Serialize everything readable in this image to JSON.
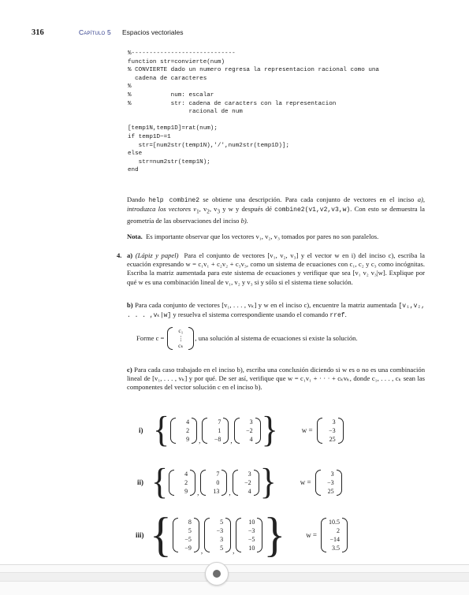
{
  "header": {
    "page_number": "316",
    "chapter": "Capítulo 5",
    "chapter_title": "Espacios vectoriales"
  },
  "code": "%-----------------------------\nfunction str=convierte(num)\n% CONVIERTE dado un numero regresa la representacion racional como una\n  cadena de caracteres\n%\n%           num: escalar\n%           str: cadena de caracters con la representacion\n                 racional de num\n\n[temp1N,temp1D]=rat(num);\nif temp1D~=1\n   str=[num2str(temp1N),'/',num2str(temp1D)];\nelse\n   str=num2str(temp1N);\nend",
  "para1": {
    "a": "Dando ",
    "cmd1": "help combine2",
    "b": " se obtiene una descripción. Para cada conjunto de vectores en el inciso ",
    "c": "a), introduzca los vectores v",
    "d": ", v",
    "e": ", v",
    "f": " y w y después dé ",
    "cmd2": "combine2(v1,v2,v3,w)",
    "g": ". Con esto se demuestra la geometría de las observaciones del inciso ",
    "h": "b)."
  },
  "nota": {
    "label": "Nota.",
    "text": "Es importante observar que los vectores v₁, v₂, v₃ tomados por pares no son paralelos."
  },
  "ex4": {
    "number": "4.",
    "a_label": "a)",
    "a_tag": "(Lápiz y papel)",
    "a_text": "Para el conjunto de vectores [v₁, v₂, v₃] y el vector w en i) del inciso c), escriba la ecuación expresando w = c₁v₁ + c₂v₂ + c₃v₃, como un sistema de ecuaciones con c₁, c₂ y c₃ como incógnitas. Escriba la matriz aumentada para este sistema de ecuaciones y verifique que sea [v₁ v₂ v₃|w]. Explique por qué w es una combinación lineal de v₁, v₂ y v₃ si y sólo si el sistema tiene solución.",
    "b_label": "b)",
    "b_text1": "Para cada conjunto de vectores [v₁, . . . , vₖ] y w en el inciso c), encuentre la matriz aumentada",
    "b_mono": "[v₁,v₂, . . . ,vₖ|w]",
    "b_text2": " y resuelva el sistema correspondiente usando el comando ",
    "b_cmd": "rref",
    "b_text3": ".",
    "forme": "Forme c =",
    "c_entries": [
      "c₁",
      "⋮",
      "cₖ"
    ],
    "forme_after": ", una solución al sistema de ecuaciones si existe la solución.",
    "c_label": "c)",
    "c_text": "Para cada caso trabajado en el inciso b), escriba una conclusión diciendo si w es o no es una combinación lineal de [v₁, . . . , vₖ] y por qué. De ser así, verifique que w = c₁v₁ + · · · + cₖvₖ, donde c₁, . . . , cₖ sean las componentes del vector solución c en el inciso b)."
  },
  "cases": [
    {
      "label": "i)",
      "vectors": [
        [
          "4",
          "2",
          "9"
        ],
        [
          "7",
          "1",
          "−8"
        ],
        [
          "3",
          "−2",
          "4"
        ]
      ],
      "w": [
        "3",
        "−3",
        "25"
      ]
    },
    {
      "label": "ii)",
      "vectors": [
        [
          "4",
          "2",
          "9"
        ],
        [
          "7",
          "0",
          "13"
        ],
        [
          "3",
          "−2",
          "4"
        ]
      ],
      "w": [
        "3",
        "−3",
        "25"
      ]
    },
    {
      "label": "iii)",
      "vectors": [
        [
          "8",
          "5",
          "−5",
          "−9"
        ],
        [
          "5",
          "−3",
          "3",
          "5"
        ],
        [
          "10",
          "−3",
          "−5",
          "10"
        ]
      ],
      "w": [
        "10.5",
        "2",
        "−14",
        "3.5"
      ]
    }
  ],
  "w_eq": "w ="
}
